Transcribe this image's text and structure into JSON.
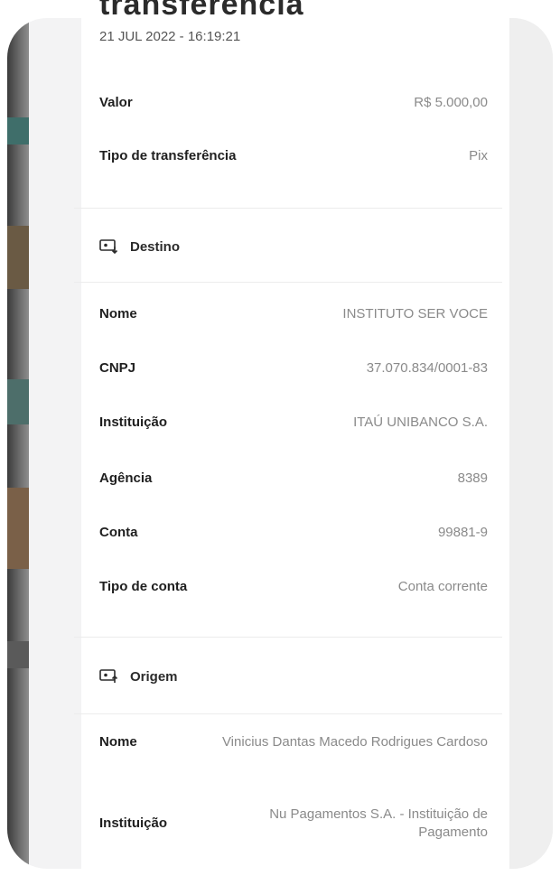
{
  "header": {
    "title_partial": "transferência",
    "date": "21 JUL 2022 - 16:19:21"
  },
  "summary": {
    "valor_label": "Valor",
    "valor_value": "R$ 5.000,00",
    "tipo_label": "Tipo de transferência",
    "tipo_value": "Pix"
  },
  "destino": {
    "section_label": "Destino",
    "icon": "inbound-arrow-icon",
    "rows": [
      {
        "label": "Nome",
        "value": "INSTITUTO SER VOCE"
      },
      {
        "label": "CNPJ",
        "value": "37.070.834/0001-83"
      },
      {
        "label": "Instituição",
        "value": "ITAÚ UNIBANCO S.A."
      },
      {
        "label": "Agência",
        "value": "8389"
      },
      {
        "label": "Conta",
        "value": "99881-9"
      },
      {
        "label": "Tipo de conta",
        "value": "Conta corrente"
      }
    ]
  },
  "origem": {
    "section_label": "Origem",
    "icon": "outbound-arrow-icon",
    "rows": [
      {
        "label": "Nome",
        "value": "Vinicius Dantas Macedo Rodrigues Cardoso"
      },
      {
        "label": "Instituição",
        "value": "Nu Pagamentos S.A. - Instituição de Pagamento"
      }
    ]
  }
}
